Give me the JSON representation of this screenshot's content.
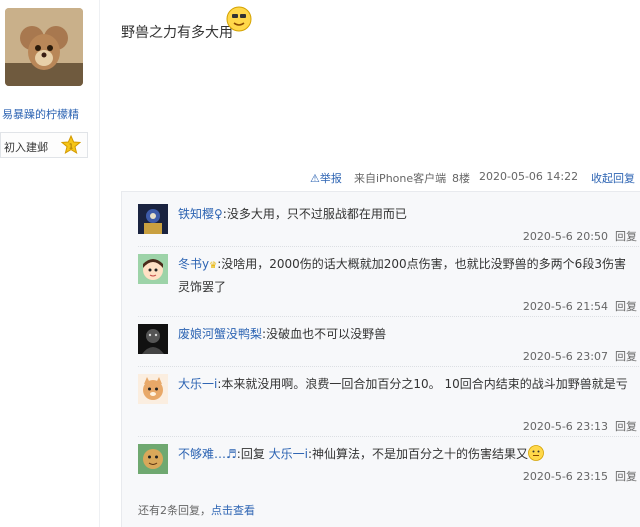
{
  "author": {
    "name": "易暴躁的柠檬精",
    "level_title": "初入建邺",
    "avatar": "tom-and-jerry-mouse-avatar",
    "badge_icon": "star-badge-icon"
  },
  "post": {
    "text": "野兽之力有多大用",
    "emoji": "smiley-emoji"
  },
  "meta": {
    "report": "举报",
    "source": "来自iPhone客户端",
    "floor": "8楼",
    "datetime": "2020-05-06 14:22",
    "collapse": "收起回复"
  },
  "replies": [
    {
      "name": "铁知樱♀",
      "sep": ":",
      "text": "没多大用，只不过服战都在用而已",
      "time": "2020-5-6 20:50",
      "action": "回复",
      "avatar": "anime-avatar-dark"
    },
    {
      "name": "冬书y",
      "sep": ":",
      "text": "没啥用，2000伤的话大概就加200点伤害，也就比没野兽的多两个6段3伤害灵饰罢了",
      "time": "2020-5-6 21:54",
      "action": "回复",
      "avatar": "cartoon-girl-avatar"
    },
    {
      "name": "废娘河蟹没鸭梨",
      "sep": ":",
      "text": "没破血也不可以没野兽",
      "time": "2020-5-6 23:07",
      "action": "回复",
      "avatar": "dark-figure-avatar"
    },
    {
      "name": "大乐一i",
      "sep": ":",
      "text": "本来就没用啊。浪费一回合加百分之10。 10回合内结束的战斗加野兽就是亏",
      "time": "2020-5-6 23:13",
      "action": "回复",
      "avatar": "cat-avatar"
    },
    {
      "name": "不够难…♬",
      "sep": ":",
      "prefix": "回复",
      "mention": "大乐一i",
      "text": ":神仙算法，不是加百分之十的伤害结果又",
      "time": "2020-5-6 23:15",
      "action": "回复",
      "avatar": "cartoon-face-avatar"
    }
  ],
  "more": {
    "text": "还有2条回复，",
    "link": "点击查看"
  },
  "colors": {
    "link": "#2d64b3",
    "reply_bg": "#f7f8fa"
  }
}
